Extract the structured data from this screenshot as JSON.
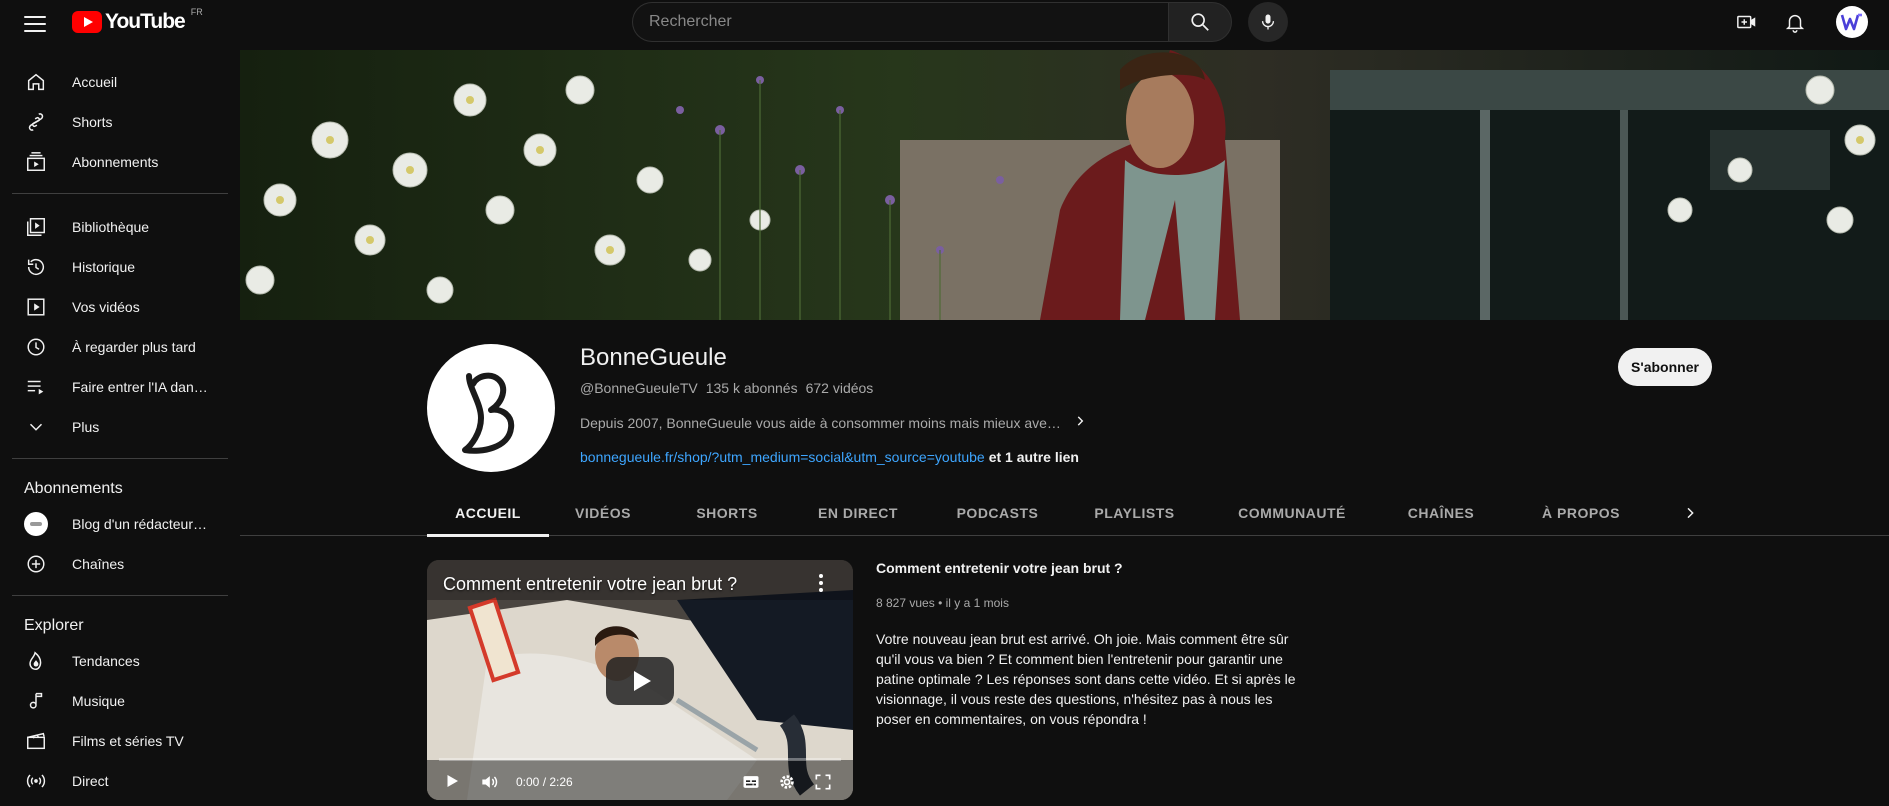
{
  "header": {
    "logo_text": "YouTube",
    "country": "FR",
    "search_placeholder": "Rechercher"
  },
  "sidebar": {
    "main": [
      {
        "label": "Accueil",
        "icon": "home-icon"
      },
      {
        "label": "Shorts",
        "icon": "shorts-icon"
      },
      {
        "label": "Abonnements",
        "icon": "subscriptions-icon"
      }
    ],
    "library": [
      {
        "label": "Bibliothèque",
        "icon": "library-icon"
      },
      {
        "label": "Historique",
        "icon": "history-icon"
      },
      {
        "label": "Vos vidéos",
        "icon": "your-videos-icon"
      },
      {
        "label": "À regarder plus tard",
        "icon": "watch-later-icon"
      },
      {
        "label": "Faire entrer l'IA dan…",
        "icon": "playlist-icon"
      },
      {
        "label": "Plus",
        "icon": "chevron-down-icon"
      }
    ],
    "subscriptions_heading": "Abonnements",
    "subscriptions": [
      {
        "label": "Blog d'un rédacteur…"
      },
      {
        "label": "Chaînes"
      }
    ],
    "explore_heading": "Explorer",
    "explore": [
      {
        "label": "Tendances",
        "icon": "trending-icon"
      },
      {
        "label": "Musique",
        "icon": "music-icon"
      },
      {
        "label": "Films et séries TV",
        "icon": "film-icon"
      },
      {
        "label": "Direct",
        "icon": "live-icon"
      }
    ]
  },
  "channel": {
    "name": "BonneGueule",
    "handle": "@BonneGueuleTV",
    "subscribers": "135 k abonnés",
    "videos_count": "672 vidéos",
    "description": "Depuis 2007, BonneGueule vous aide à consommer moins mais mieux ave…",
    "link": "bonnegueule.fr/shop/?utm_medium=social&utm_source=youtube",
    "more_links": "et 1 autre lien",
    "subscribe_label": "S'abonner",
    "avatar_letter": "B"
  },
  "tabs": [
    "ACCUEIL",
    "VIDÉOS",
    "SHORTS",
    "EN DIRECT",
    "PODCASTS",
    "PLAYLISTS",
    "COMMUNAUTÉ",
    "CHAÎNES",
    "À PROPOS"
  ],
  "featured": {
    "player_title": "Comment entretenir votre jean brut ?",
    "time": "0:00 / 2:26",
    "title": "Comment entretenir votre jean brut ?",
    "views": "8 827 vues",
    "age": "il y a 1 mois",
    "description": "Votre nouveau jean brut est arrivé. Oh joie. Mais comment être sûr qu'il vous va bien ? Et comment bien l'entretenir pour garantir une patine optimale ? Les réponses sont dans cette vidéo. Et si après le visionnage, il vous reste des questions, n'hésitez pas à nous les poser en commentaires, on vous répondra !"
  }
}
